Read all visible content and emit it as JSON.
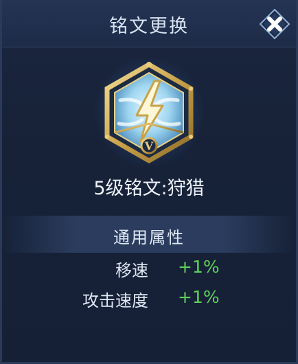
{
  "header": {
    "title": "铭文更换",
    "close_icon": "close-icon"
  },
  "rune": {
    "icon": "lightning-rune-icon",
    "tier_mark": "V",
    "name": "5级铭文:狩猎"
  },
  "attributes_section": {
    "title": "通用属性",
    "items": [
      {
        "label": "移速",
        "value": "+1%"
      },
      {
        "label": "攻击速度",
        "value": "+1%"
      }
    ]
  },
  "colors": {
    "positive_value": "#5fcf5a",
    "frame_gold": "#c9a24a",
    "rune_ice": "#9fd6f0"
  }
}
